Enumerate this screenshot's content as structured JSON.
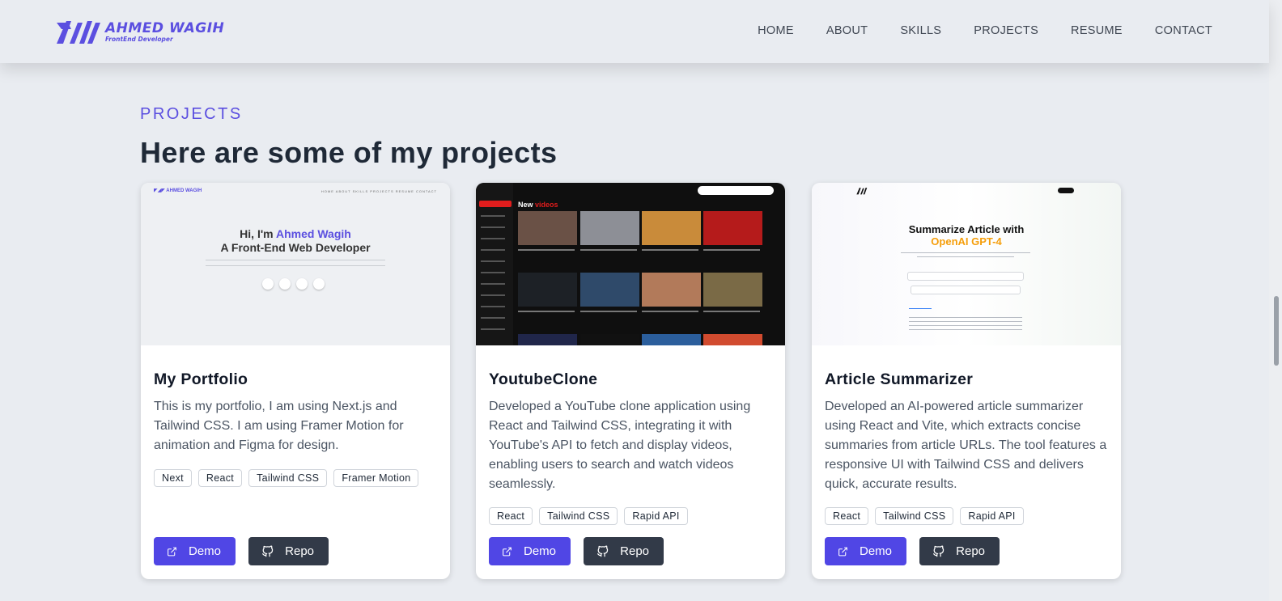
{
  "header": {
    "logo_name": "AHMED WAGIH",
    "logo_subtitle": "FrontEnd Developer",
    "nav": [
      "HOME",
      "ABOUT",
      "SKILLS",
      "PROJECTS",
      "RESUME",
      "CONTACT"
    ]
  },
  "section": {
    "label": "PROJECTS",
    "title": "Here are some of my projects"
  },
  "colors": {
    "accent": "#5046e5",
    "repo_button": "#323a48",
    "background": "#e9ecf1"
  },
  "projects": [
    {
      "title": "My Portfolio",
      "description": "This is my portfolio, I am using Next.js and Tailwind CSS. I am using Framer Motion for animation and Figma for design.",
      "tags": [
        "Next",
        "React",
        "Tailwind CSS",
        "Framer Motion"
      ],
      "demo_label": "Demo",
      "repo_label": "Repo",
      "preview": {
        "hero_line1": "Hi, I'm ",
        "hero_name": "Ahmed Wagih",
        "hero_line2": "A Front-End Web Developer"
      }
    },
    {
      "title": "YoutubeClone",
      "description": "Developed a YouTube clone application using React and Tailwind CSS, integrating it with YouTube's API to fetch and display videos, enabling users to search and watch videos seamlessly.",
      "tags": [
        "React",
        "Tailwind CSS",
        "Rapid API"
      ],
      "demo_label": "Demo",
      "repo_label": "Repo",
      "preview": {
        "heading_a": "New ",
        "heading_b": "videos"
      }
    },
    {
      "title": "Article Summarizer",
      "description": "Developed an AI-powered article summarizer using React and Vite, which extracts concise summaries from article URLs. The tool features a responsive UI with Tailwind CSS and delivers quick, accurate results.",
      "tags": [
        "React",
        "Tailwind CSS",
        "Rapid API"
      ],
      "demo_label": "Demo",
      "repo_label": "Repo",
      "preview": {
        "title_line1": "Summarize Article with",
        "title_line2": "OpenAI GPT-4"
      }
    }
  ]
}
